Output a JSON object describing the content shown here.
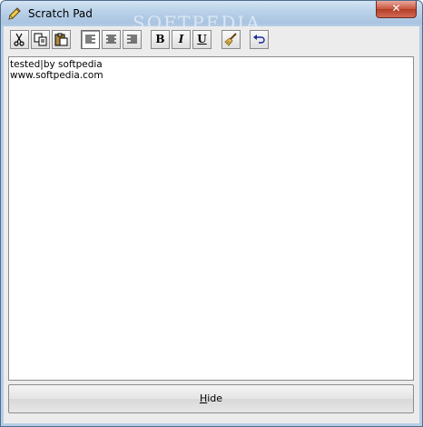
{
  "window": {
    "title": "Scratch Pad",
    "close_label": "✕",
    "watermark": "SOFTPEDIA"
  },
  "toolbar": {
    "bold_label": "B",
    "italic_label": "I",
    "underline_label": "U"
  },
  "editor": {
    "lines": [
      "tested|by softpedia",
      "www.softpedia.com"
    ]
  },
  "footer": {
    "hide_mnemonic": "H",
    "hide_rest": "ide"
  }
}
